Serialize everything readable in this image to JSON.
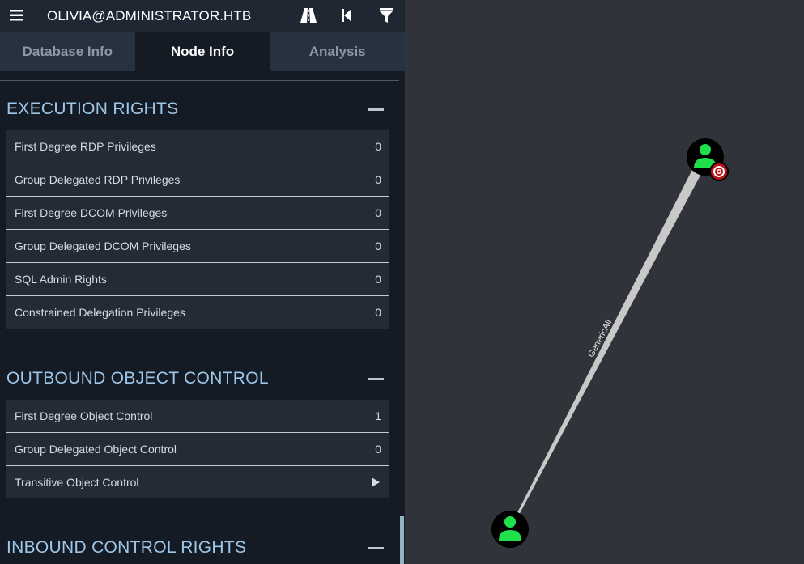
{
  "header": {
    "title": "OLIVIA@ADMINISTRATOR.HTB",
    "menu_icon": "hamburger-menu-icon",
    "icons": [
      "pathfinding-road-icon",
      "back-icon",
      "filter-icon"
    ]
  },
  "tabs": [
    {
      "label": "Database Info",
      "active": false
    },
    {
      "label": "Node Info",
      "active": true
    },
    {
      "label": "Analysis",
      "active": false
    }
  ],
  "sections": {
    "execution_rights": {
      "title": "EXECUTION RIGHTS",
      "rows": [
        {
          "label": "First Degree RDP Privileges",
          "value": "0"
        },
        {
          "label": "Group Delegated RDP Privileges",
          "value": "0"
        },
        {
          "label": "First Degree DCOM Privileges",
          "value": "0"
        },
        {
          "label": "Group Delegated DCOM Privileges",
          "value": "0"
        },
        {
          "label": "SQL Admin Rights",
          "value": "0"
        },
        {
          "label": "Constrained Delegation Privileges",
          "value": "0"
        }
      ]
    },
    "outbound_object_control": {
      "title": "OUTBOUND OBJECT CONTROL",
      "rows": [
        {
          "label": "First Degree Object Control",
          "value": "1"
        },
        {
          "label": "Group Delegated Object Control",
          "value": "0"
        },
        {
          "label": "Transitive Object Control",
          "value": ""
        }
      ]
    },
    "inbound_control_rights": {
      "title": "INBOUND CONTROL RIGHTS"
    }
  },
  "graph": {
    "edge_label": "GenericAll",
    "source_node": "user-node",
    "target_node": "user-node-target",
    "target_badge": "target-icon",
    "colors": {
      "node_icon": "#1fe04a",
      "node_bg": "#000000",
      "edge": "#c8c8c8",
      "badge": "#c0101a"
    }
  }
}
